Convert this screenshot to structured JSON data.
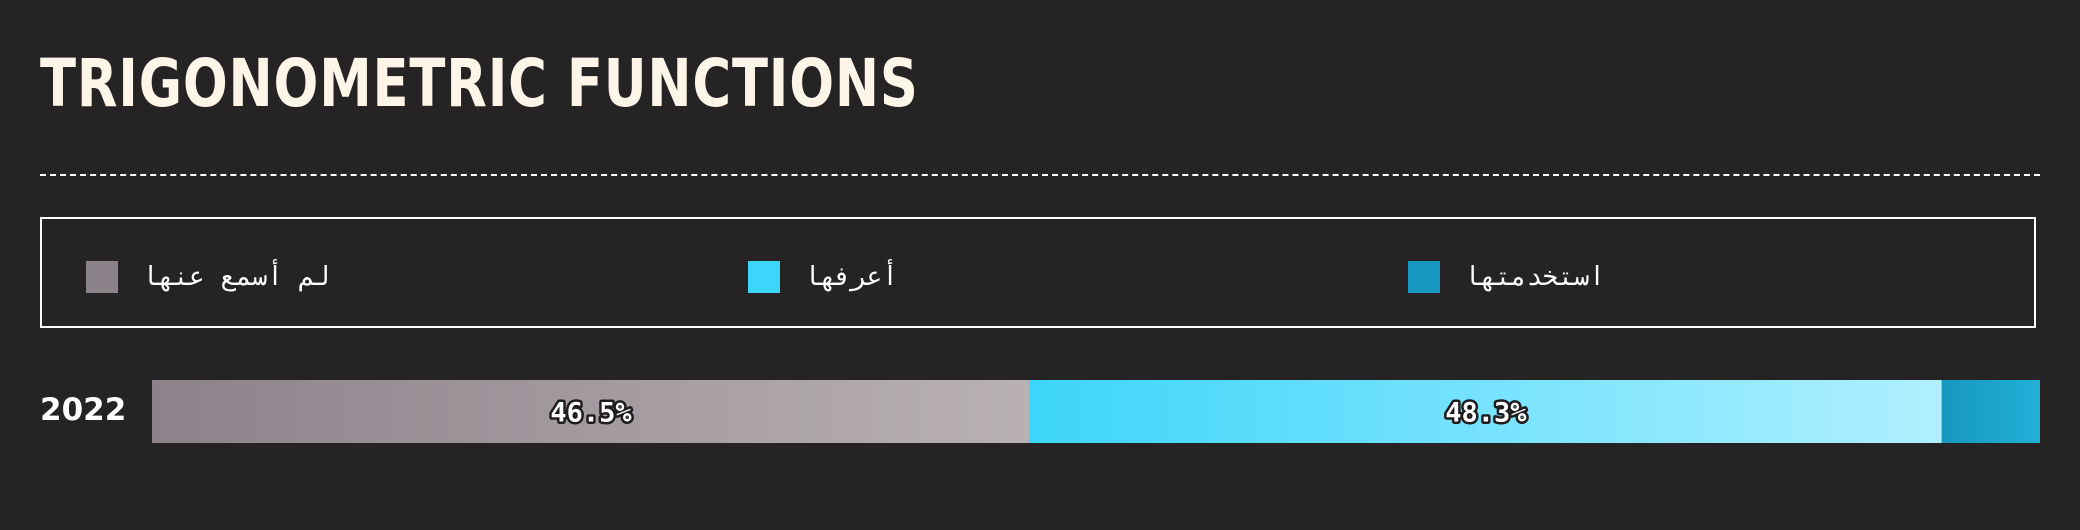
{
  "chart_data": {
    "type": "bar",
    "orientation": "horizontal",
    "stacked": true,
    "normalized": true,
    "title": "TRIGONOMETRIC FUNCTIONS",
    "categories": [
      "2022"
    ],
    "series": [
      {
        "name": "لم أسمع عنها",
        "values": [
          46.5
        ],
        "data_label": "46.5%",
        "color": "#8b8389",
        "color_end": "#b8b1b5"
      },
      {
        "name": "أعرفها",
        "values": [
          48.3
        ],
        "data_label": "48.3%",
        "color": "#3dd5fa",
        "color_end": "#b0f0ff"
      },
      {
        "name": "استخدمتها",
        "values": [
          5.2
        ],
        "data_label": "",
        "color": "#1797c0",
        "color_end": "#22b0d8"
      }
    ],
    "xlim": [
      0,
      100
    ],
    "legend_position": "top",
    "grid": false
  }
}
